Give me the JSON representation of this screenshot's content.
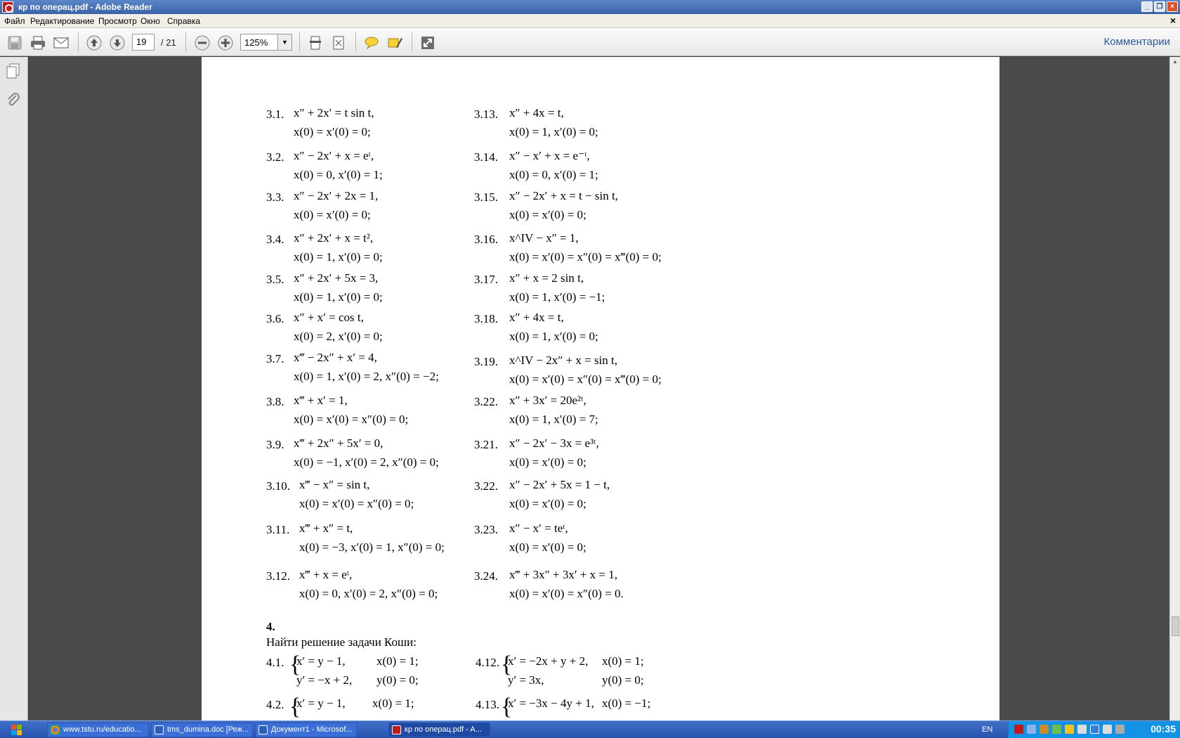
{
  "window": {
    "title": "кр по операц.pdf - Adobe Reader",
    "buttons": [
      "_",
      "❐",
      "×"
    ]
  },
  "menu": {
    "items": [
      "Файл",
      "Редактирование",
      "Просмотр",
      "Окно",
      "Справка"
    ],
    "close": "×"
  },
  "toolbar": {
    "current_page": "19",
    "total_pages": "/  21",
    "zoom": "125%",
    "comments_label": "Комментарии",
    "icons": [
      "save-icon",
      "print-icon",
      "email-icon",
      "page-up-icon",
      "page-down-icon",
      "zoom-out-icon",
      "zoom-in-icon",
      "fit-page-icon",
      "fit-width-icon",
      "comment-icon",
      "highlight-icon",
      "fullscreen-icon"
    ]
  },
  "document": {
    "left_col": [
      {
        "n": "3.1.",
        "eq": "x″ + 2x′ = t sin t,",
        "ic": "x(0) = x′(0) = 0;"
      },
      {
        "n": "3.2.",
        "eq": "x″ − 2x′ + x = eᵗ,",
        "ic": "x(0) = 0,  x′(0) = 1;"
      },
      {
        "n": "3.3.",
        "eq": "x″ − 2x′ + 2x = 1,",
        "ic": "x(0) = x′(0) = 0;"
      },
      {
        "n": "3.4.",
        "eq": "x″ + 2x′ + x = t²,",
        "ic": "x(0) = 1,  x′(0) = 0;"
      },
      {
        "n": "3.5.",
        "eq": "x″ + 2x′ + 5x = 3,",
        "ic": "x(0) = 1,  x′(0) = 0;"
      },
      {
        "n": "3.6.",
        "eq": "x″ + x′ = cos t,",
        "ic": "x(0) = 2,   x′(0) = 0;"
      },
      {
        "n": "3.7.",
        "eq": "x‴ − 2x″ + x′ = 4,",
        "ic": "x(0) = 1, x′(0) = 2,  x″(0) = −2;"
      },
      {
        "n": "3.8.",
        "eq": "x‴ + x′ = 1,",
        "ic": "x(0) = x′(0) = x″(0) = 0;"
      },
      {
        "n": "3.9.",
        "eq": "x‴ + 2x″ + 5x′ = 0,",
        "ic": "x(0) = −1, x′(0) = 2, x″(0) = 0;"
      },
      {
        "n": "3.10.",
        "eq": "x‴ − x″ = sin t,",
        "ic": "x(0) = x′(0) = x″(0) = 0;"
      },
      {
        "n": "3.11.",
        "eq": "x‴ + x″ = t,",
        "ic": "x(0) = −3, x′(0) = 1, x″(0) = 0;"
      },
      {
        "n": "3.12.",
        "eq": "x‴ + x = eᵗ,",
        "ic": "x(0) = 0,  x′(0) = 2,  x″(0) = 0;"
      }
    ],
    "right_col": [
      {
        "n": "3.13.",
        "eq": "x″ + 4x = t,",
        "ic": "x(0) = 1,  x′(0) = 0;"
      },
      {
        "n": "3.14.",
        "eq": "x″ − x′ + x = e⁻ᵗ,",
        "ic": "x(0) = 0,  x′(0) = 1;"
      },
      {
        "n": "3.15.",
        "eq": "x″ − 2x′ + x = t − sin t,",
        "ic": "x(0) = x′(0) = 0;"
      },
      {
        "n": "3.16.",
        "eq": "x^IV − x″ = 1,",
        "ic": "x(0) = x′(0) = x″(0) = x‴(0) = 0;"
      },
      {
        "n": "3.17.",
        "eq": "x″ + x = 2 sin t,",
        "ic": "x(0) = 1,   x′(0) = −1;"
      },
      {
        "n": "3.18.",
        "eq": "x″ + 4x = t,",
        "ic": "x(0) = 1,    x′(0) = 0;"
      },
      {
        "n": "3.19.",
        "eq": "x^IV − 2x″ + x = sin t,",
        "ic": "x(0) = x′(0) = x″(0) = x‴(0) = 0;"
      },
      {
        "n": "3.22.",
        "eq": "x″ + 3x′ = 20e²ᵗ,",
        "ic": "x(0) = 1,  x′(0) = 7;"
      },
      {
        "n": "3.21.",
        "eq": "x″ − 2x′ − 3x = e³ᵗ,",
        "ic": "x(0) = x′(0) = 0;"
      },
      {
        "n": "3.22.",
        "eq": "x″ − 2x′ + 5x = 1 − t,",
        "ic": "x(0) = x′(0) = 0;"
      },
      {
        "n": "3.23.",
        "eq": "x″ − x′ = teᵗ,",
        "ic": "x(0) = x′(0) = 0;"
      },
      {
        "n": "3.24.",
        "eq": "x‴ + 3x″ + 3x′ + x = 1,",
        "ic": "x(0) = x′(0) = x″(0) = 0."
      }
    ],
    "section4_num": "4.",
    "section4_text": "Найти решение задачи Коши:",
    "systems": [
      {
        "n": "4.1.",
        "l1": "x′ = y − 1,",
        "r1": "x(0) = 1;",
        "l2": "y′ = −x + 2,",
        "r2": "y(0) = 0;"
      },
      {
        "n": "4.12.",
        "l1": "x′ = −2x + y + 2,",
        "r1": "x(0) = 1;",
        "l2": "y′ = 3x,",
        "r2": "y(0) = 0;"
      },
      {
        "n": "4.2.",
        "l1": "x′ = y − 1,",
        "r1": "x(0) = 1;"
      },
      {
        "n": "4.13.",
        "l1": "x′ = −3x − 4y + 1,",
        "r1": "x(0) = −1;"
      }
    ]
  },
  "taskbar": {
    "tasks": [
      "www.tstu.ru/educatio...",
      "tms_dumina.doc [Реж...",
      "Документ1 - Microsof...",
      "кр по операц.pdf - A..."
    ],
    "lang": "EN",
    "clock": "00:35"
  }
}
